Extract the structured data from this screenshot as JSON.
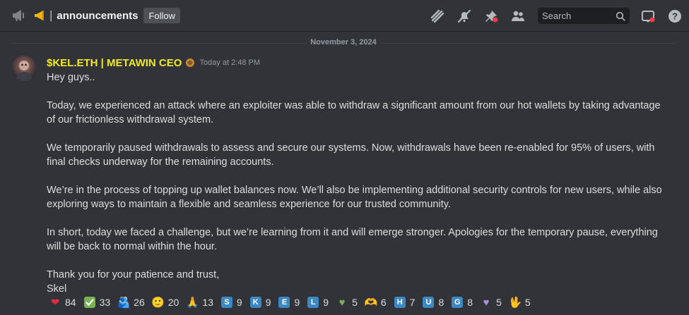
{
  "header": {
    "channel_name": "announcements",
    "separator": "|",
    "follow_label": "Follow",
    "search_placeholder": "Search"
  },
  "date_divider": "November 3, 2024",
  "message": {
    "author": "$KEL.ETH | METAWIN CEO",
    "timestamp": "Today at 2:48 PM",
    "paragraphs": [
      "Hey guys..",
      "",
      "Today, we experienced an attack where an exploiter was able to withdraw a significant amount from our hot wallets by taking advantage of our frictionless withdrawal system.",
      "",
      "We temporarily paused withdrawals to assess and secure our systems. Now, withdrawals have been re-enabled for 95% of users, with final checks underway for the remaining accounts.",
      "",
      "We’re in the process of topping up wallet balances now. We’ll also be implementing additional security controls for new users, while also exploring ways to maintain a flexible and seamless experience for our trusted community.",
      "",
      "In short, today we faced a challenge, but we’re learning from it and will emerge stronger. Apologies for the temporary pause, everything will be back to normal within the hour.",
      "",
      "Thank you for your patience and trust,",
      "Skel"
    ]
  },
  "reactions": [
    {
      "emoji": "❤",
      "kind": "heart",
      "count": "84",
      "color": "#dd2e44"
    },
    {
      "emoji": "✔",
      "kind": "check",
      "count": "33",
      "color": "#77b255"
    },
    {
      "emoji": "🫂",
      "kind": "people-hugging",
      "count": "26",
      "color": "#5d9bd8"
    },
    {
      "emoji": "🙂",
      "kind": "smile",
      "count": "20",
      "color": "#ffcc4d"
    },
    {
      "emoji": "🙏",
      "kind": "pray",
      "count": "13",
      "color": "#ffcc4d"
    },
    {
      "emoji": "S",
      "kind": "letter",
      "count": "9",
      "color": "#3b88c3"
    },
    {
      "emoji": "K",
      "kind": "letter",
      "count": "9",
      "color": "#3b88c3"
    },
    {
      "emoji": "E",
      "kind": "letter",
      "count": "9",
      "color": "#3b88c3"
    },
    {
      "emoji": "L",
      "kind": "letter",
      "count": "9",
      "color": "#3b88c3"
    },
    {
      "emoji": "♥",
      "kind": "green-heart",
      "count": "5",
      "color": "#78b159"
    },
    {
      "emoji": "🫶",
      "kind": "heart-hands",
      "count": "6",
      "color": "#ffcc4d"
    },
    {
      "emoji": "H",
      "kind": "letter",
      "count": "7",
      "color": "#3b88c3"
    },
    {
      "emoji": "U",
      "kind": "letter",
      "count": "8",
      "color": "#3b88c3"
    },
    {
      "emoji": "G",
      "kind": "letter",
      "count": "8",
      "color": "#3b88c3"
    },
    {
      "emoji": "♥",
      "kind": "purple-heart",
      "count": "5",
      "color": "#aa8ed6"
    },
    {
      "emoji": "🖖",
      "kind": "hand-fire",
      "count": "5",
      "color": "#f4900c"
    }
  ],
  "colors": {
    "background": "#313338",
    "username": "#f0e929",
    "search_bg": "#1e1f22",
    "follow_bg": "#4e5058"
  }
}
